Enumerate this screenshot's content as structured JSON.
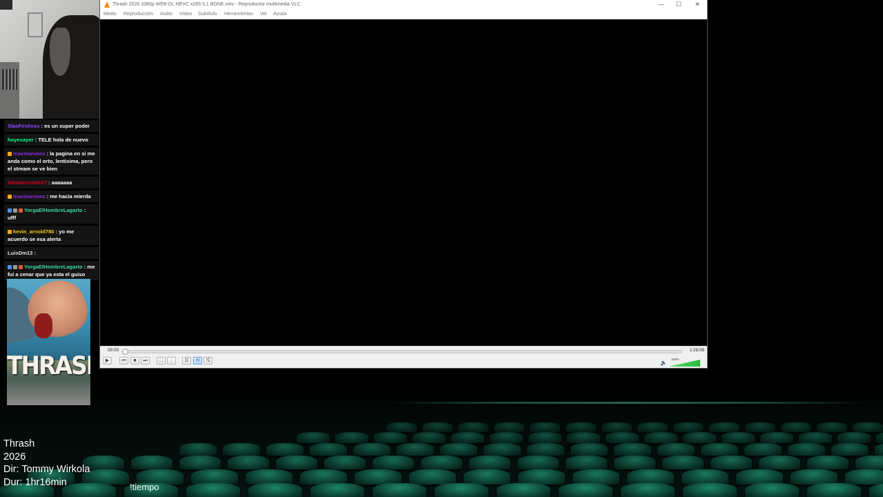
{
  "vlc": {
    "title": "Thrash 2026 1080p WEB-DL HEVC x265 5.1 BONE.mkv - Reproductor multimedia VLC",
    "menu": [
      "Medio",
      "Reproducción",
      "Audio",
      "Vídeo",
      "Subtítulo",
      "Herramientas",
      "Ver",
      "Ayuda"
    ],
    "window_buttons": {
      "minimize": "—",
      "maximize": "☐",
      "close": "✕"
    },
    "time_elapsed": "00:00",
    "time_total": "1:26:08",
    "seek_fraction": 0.0,
    "volume_label": "100%",
    "volume_fraction": 1.0,
    "controls": {
      "play": "▶",
      "prev": "⏮",
      "stop": "■",
      "next": "⏭",
      "fullscreen": "⛶",
      "extended": "⫶",
      "playlist": "☰",
      "loop": "⟲",
      "random": "⤭"
    },
    "accent": "#f08a00"
  },
  "chat": [
    {
      "user": "SlasFestivos",
      "color": "#9147ff",
      "text": ": es un super poder",
      "badges": []
    },
    {
      "user": "hoyesayer",
      "color": "#00ff7f",
      "text": ": TELE hola de nuevo",
      "badges": []
    },
    {
      "user": "maxmarveeo",
      "color": "#8a2be2",
      "text": ": la pagina en si me anda como el orto, lentisima, pero el stream se ve bien",
      "badges": [
        "#f5a623"
      ]
    },
    {
      "user": "fabiannicolas07",
      "color": "#d0021b",
      "text": ": aaaaaaa",
      "badges": []
    },
    {
      "user": "maxmarveeo",
      "color": "#8a2be2",
      "text": ": me hacia mierda",
      "badges": [
        "#f5a623"
      ]
    },
    {
      "user": "YorgaElHombreLagarto",
      "color": "#3fd6a8",
      "text": ": ufff",
      "badges": [
        "#4a90e2",
        "#9b9b9b",
        "#e8542c"
      ]
    },
    {
      "user": "kevin_arnold780",
      "color": "#f5c518",
      "text": ": yo me acuerdo se esa alerta",
      "badges": [
        "#f5a623"
      ]
    },
    {
      "user": "LuisDm13",
      "color": "#e0e0e0",
      "text": ": ",
      "badges": []
    },
    {
      "user": "YorgaElHombreLagarto",
      "color": "#3fd6a8",
      "text": ": me fui a cenar que ya esta el guiso",
      "badges": [
        "#4a90e2",
        "#9b9b9b",
        "#e8542c"
      ]
    }
  ],
  "poster": {
    "title": "THRASH"
  },
  "movie_info": {
    "title": "Thrash",
    "year": "2026",
    "director": "Dir: Tommy Wirkola",
    "duration": "Dur: 1hr16min"
  },
  "command": "!tiempo"
}
